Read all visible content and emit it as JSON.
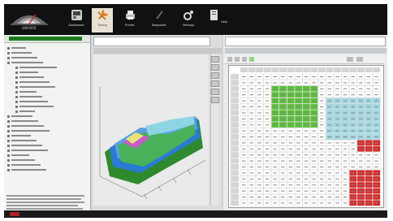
{
  "toolbar": {
    "logo_text": "SWORD",
    "buttons": [
      {
        "label": "Dashboard",
        "icon": "dashboard-icon",
        "active": false
      },
      {
        "label": "Tuning",
        "icon": "wrench-icon",
        "active": true
      },
      {
        "label": "Printer",
        "icon": "printer-icon",
        "active": false
      },
      {
        "label": "Diagnostic",
        "icon": "pen-icon",
        "active": false
      },
      {
        "label": "Settings",
        "icon": "gear-icon",
        "active": false
      },
      {
        "label": "Help",
        "icon": "book-icon",
        "active": false
      }
    ]
  },
  "colors": {
    "grid_green": "#5bbf3b",
    "grid_cyan": "#9fd8e3",
    "grid_red": "#d82b2b",
    "plot_blue": "#2a7bd2",
    "plot_green": "#3a9a3a"
  },
  "icons": {
    "tree_item": "tree-node-icon"
  }
}
